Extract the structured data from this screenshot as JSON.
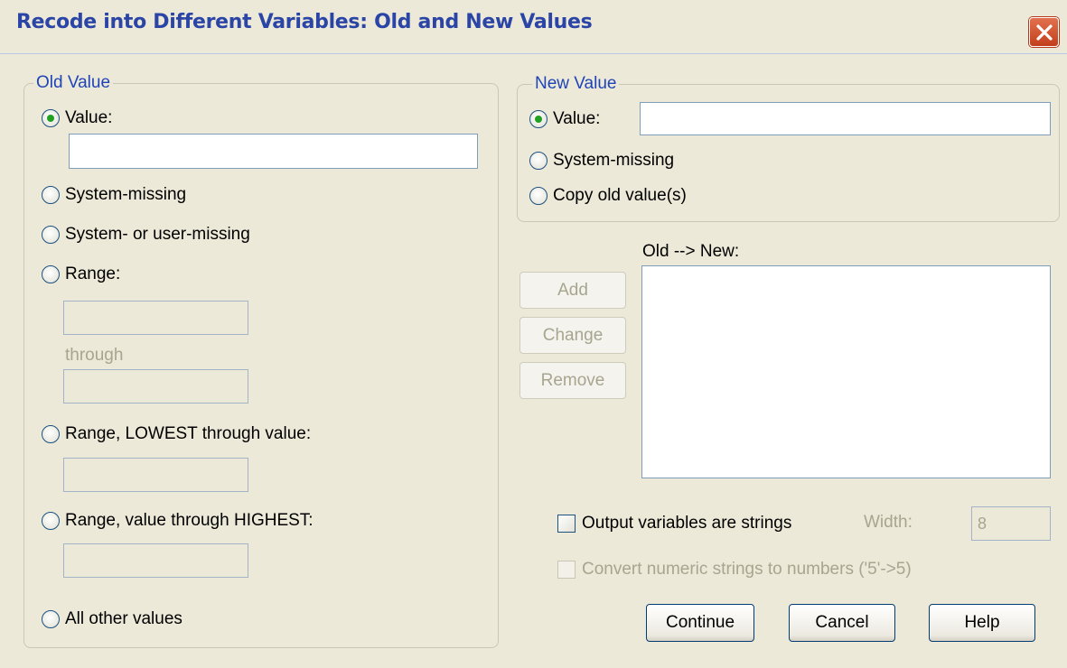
{
  "window": {
    "title": "Recode into Different Variables: Old and New Values"
  },
  "old_value": {
    "legend": "Old Value",
    "value_label": "Value:",
    "value_input": "",
    "system_missing_label": "System-missing",
    "system_or_user_missing_label": "System- or user-missing",
    "range_label": "Range:",
    "range_from": "",
    "through_label": "through",
    "range_to": "",
    "range_lowest_label": "Range, LOWEST through value:",
    "range_lowest_value": "",
    "range_highest_label": "Range, value through HIGHEST:",
    "range_highest_value": "",
    "all_other_label": "All other values",
    "selected": "value"
  },
  "new_value": {
    "legend": "New Value",
    "value_label": "Value:",
    "value_input": "",
    "system_missing_label": "System-missing",
    "copy_old_label": "Copy old value(s)",
    "selected": "value"
  },
  "mapping": {
    "list_label": "Old --> New:",
    "items": [],
    "add_label": "Add",
    "change_label": "Change",
    "remove_label": "Remove"
  },
  "options": {
    "output_strings_label": "Output variables are strings",
    "output_strings_checked": false,
    "width_label": "Width:",
    "width_value": "8",
    "convert_numeric_label": "Convert numeric strings to numbers ('5'->5)",
    "convert_numeric_checked": false
  },
  "buttons": {
    "continue_label": "Continue",
    "cancel_label": "Cancel",
    "help_label": "Help"
  }
}
